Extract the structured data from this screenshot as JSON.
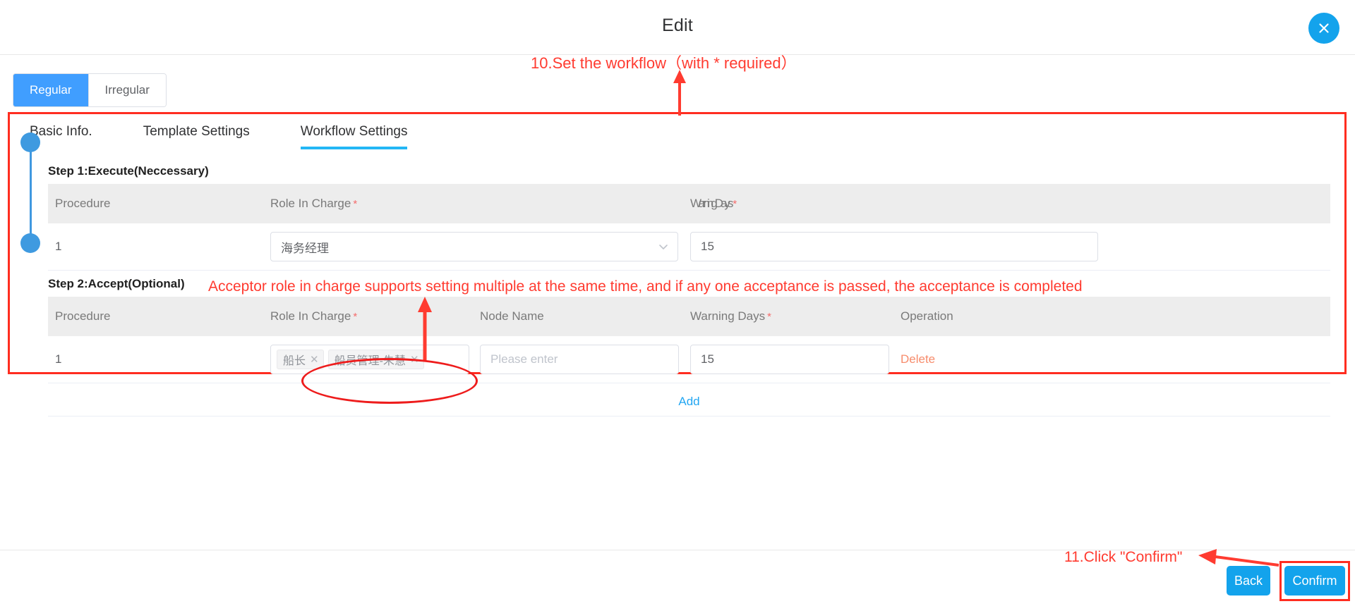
{
  "dialog": {
    "title": "Edit",
    "close_icon": "close-icon"
  },
  "segmented": {
    "options": [
      {
        "label": "Regular",
        "active": true
      },
      {
        "label": "Irregular",
        "active": false
      }
    ]
  },
  "inner_tabs": [
    {
      "label": "Basic Info.",
      "active": false
    },
    {
      "label": "Template Settings",
      "active": false
    },
    {
      "label": "Workflow Settings",
      "active": true
    }
  ],
  "step1": {
    "title": "Step 1:Execute(Neccessary)",
    "columns": [
      "Procedure",
      "Role In Charge",
      "WarningDays"
    ],
    "required_flags": [
      false,
      true,
      true
    ],
    "rows": [
      {
        "procedure": "1",
        "role_in_charge": "海务经理",
        "warning_days": "15"
      }
    ]
  },
  "step2": {
    "title": "Step 2:Accept(Optional)",
    "columns": [
      "Procedure",
      "Role In Charge",
      "Node Name",
      "Warning Days",
      "Operation"
    ],
    "required_flags": [
      false,
      true,
      false,
      true,
      false
    ],
    "rows": [
      {
        "procedure": "1",
        "role_tags": [
          "船长",
          "船员管理-朱慧"
        ],
        "node_name_placeholder": "Please enter",
        "node_name_value": "",
        "warning_days": "15",
        "operation": "Delete"
      }
    ],
    "add_label": "Add"
  },
  "footer": {
    "back_label": "Back",
    "confirm_label": "Confirm"
  },
  "annotations": {
    "step10": "10.Set the workflow（with * required）",
    "step2_note": "Acceptor role in charge supports setting multiple at the same time, and if any one acceptance is passed, the acceptance is completed",
    "step11": "11.Click \"Confirm\""
  },
  "colors": {
    "accent_blue": "#409eff",
    "link_blue": "#22a6f2",
    "annotation_red": "#ff3b30",
    "highlight_red": "#ff2d20",
    "danger_orange": "#f78c6c",
    "header_gray": "#ededed"
  }
}
